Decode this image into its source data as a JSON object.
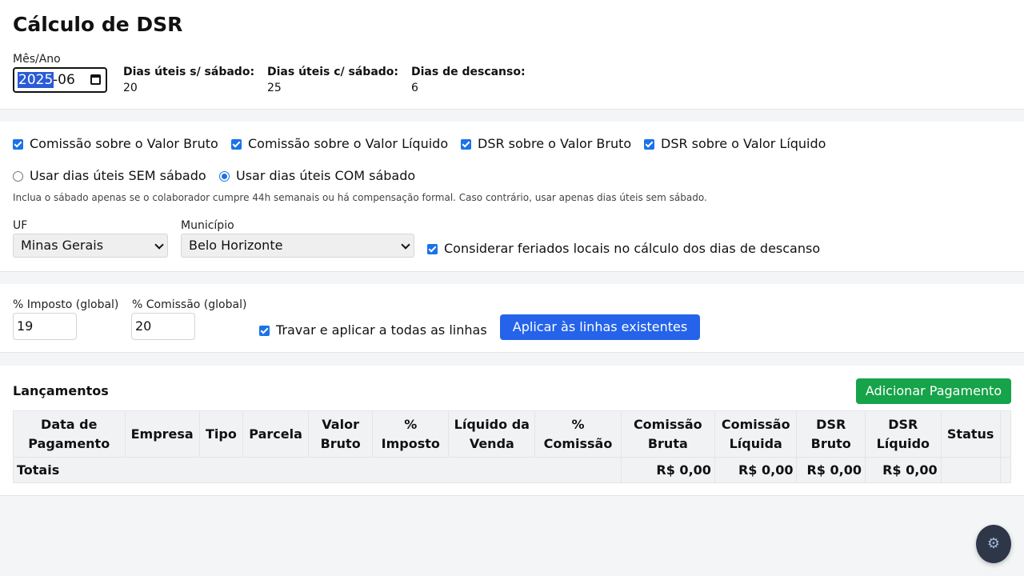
{
  "header": {
    "title": "Cálculo de DSR",
    "month_label": "Mês/Ano",
    "month_year_selected": "2025",
    "month_rest": "-06",
    "stats": [
      {
        "label": "Dias úteis s/ sábado:",
        "value": "20"
      },
      {
        "label": "Dias úteis c/ sábado:",
        "value": "25"
      },
      {
        "label": "Dias de descanso:",
        "value": "6"
      }
    ]
  },
  "options": {
    "checkboxes": [
      {
        "label": "Comissão sobre o Valor Bruto",
        "checked": true
      },
      {
        "label": "Comissão sobre o Valor Líquido",
        "checked": true
      },
      {
        "label": "DSR sobre o Valor Bruto",
        "checked": true
      },
      {
        "label": "DSR sobre o Valor Líquido",
        "checked": true
      }
    ],
    "radios": [
      {
        "label": "Usar dias úteis SEM sábado",
        "checked": false
      },
      {
        "label": "Usar dias úteis COM sábado",
        "checked": true
      }
    ],
    "note": "Inclua o sábado apenas se o colaborador cumpre 44h semanais ou há compensação formal. Caso contrário, usar apenas dias úteis sem sábado.",
    "uf_label": "UF",
    "uf_value": "Minas Gerais",
    "municipio_label": "Município",
    "municipio_value": "Belo Horizonte",
    "local_holidays_label": "Considerar feriados locais no cálculo dos dias de descanso"
  },
  "taxes": {
    "imposto_label": "% Imposto (global)",
    "imposto_value": "19",
    "comissao_label": "% Comissão (global)",
    "comissao_value": "20",
    "lock_label": "Travar e aplicar a todas as linhas",
    "apply_button": "Aplicar às linhas existentes"
  },
  "entries": {
    "title": "Lançamentos",
    "add_button": "Adicionar Pagamento",
    "columns": [
      [
        "Data de",
        "Pagamento"
      ],
      [
        "Empresa"
      ],
      [
        "Tipo"
      ],
      [
        "Parcela"
      ],
      [
        "Valor",
        "Bruto"
      ],
      [
        "%",
        "Imposto"
      ],
      [
        "Líquido da",
        "Venda"
      ],
      [
        "%",
        "Comissão"
      ],
      [
        "Comissão",
        "Bruta"
      ],
      [
        "Comissão",
        "Líquida"
      ],
      [
        "DSR",
        "Bruto"
      ],
      [
        "DSR",
        "Líquido"
      ],
      [
        "Status"
      ]
    ],
    "totals_label": "Totais",
    "totals": [
      "R$ 0,00",
      "R$ 0,00",
      "R$ 0,00",
      "R$ 0,00"
    ]
  },
  "settings_fab_icon": "gear-icon"
}
